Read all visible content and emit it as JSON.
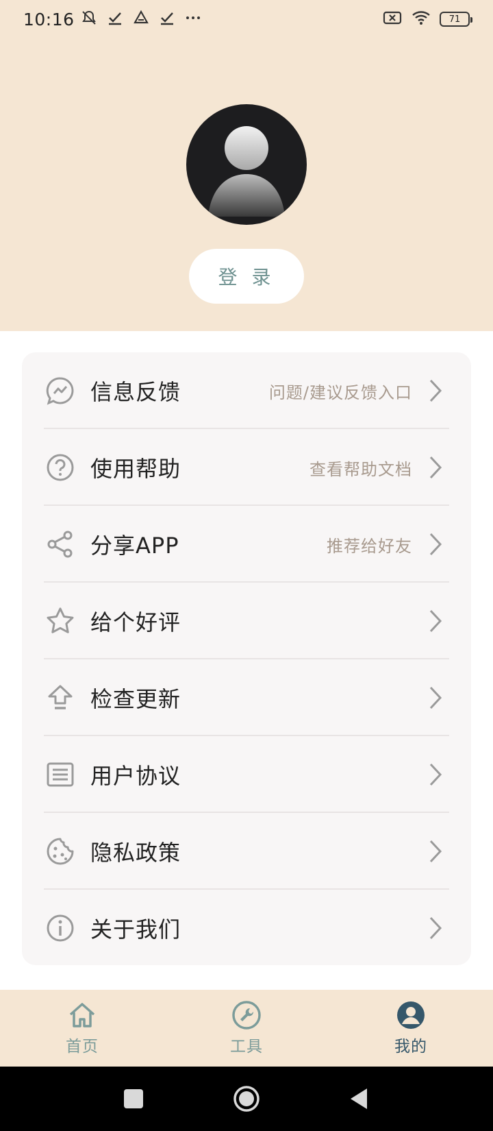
{
  "status_bar": {
    "time": "10:16",
    "icons": [
      "notifications-off-icon",
      "check-icon",
      "drive-icon",
      "check-icon",
      "more-icon"
    ],
    "right_icons": [
      "sim-off-icon",
      "wifi-icon",
      "battery-icon"
    ],
    "battery_level": "71"
  },
  "profile": {
    "avatar_icon": "default-user-avatar",
    "login_label": "登 录"
  },
  "menu": {
    "items": [
      {
        "icon": "feedback-icon",
        "label": "信息反馈",
        "hint": "问题/建议反馈入口"
      },
      {
        "icon": "help-icon",
        "label": "使用帮助",
        "hint": "查看帮助文档"
      },
      {
        "icon": "share-icon",
        "label": "分享APP",
        "hint": "推荐给好友"
      },
      {
        "icon": "star-icon",
        "label": "给个好评",
        "hint": ""
      },
      {
        "icon": "update-icon",
        "label": "检查更新",
        "hint": ""
      },
      {
        "icon": "document-icon",
        "label": "用户协议",
        "hint": ""
      },
      {
        "icon": "cookie-icon",
        "label": "隐私政策",
        "hint": ""
      },
      {
        "icon": "info-icon",
        "label": "关于我们",
        "hint": ""
      }
    ]
  },
  "tabs": [
    {
      "icon": "home-icon",
      "label": "首页",
      "active": false
    },
    {
      "icon": "tools-icon",
      "label": "工具",
      "active": false
    },
    {
      "icon": "user-icon",
      "label": "我的",
      "active": true
    }
  ],
  "colors": {
    "header_bg": "#f5e6d3",
    "card_bg": "#f8f6f6",
    "accent_teal": "#6e9190",
    "active_tab": "#35576a",
    "hint_text": "#a89a8e"
  }
}
